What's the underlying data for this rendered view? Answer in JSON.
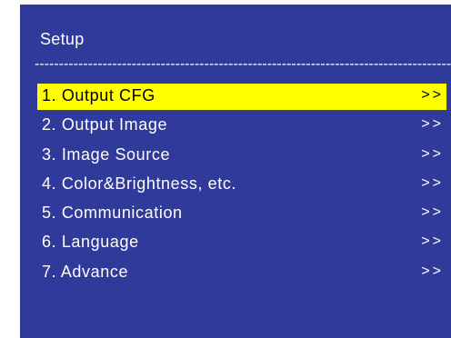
{
  "screen": {
    "title": "Setup",
    "divider": "----------------------------------------------------------------------------------------------------------------"
  },
  "menu": {
    "items": [
      {
        "label": "1. Output CFG",
        "arrow": ">>",
        "selected": true
      },
      {
        "label": "2. Output Image",
        "arrow": ">>",
        "selected": false
      },
      {
        "label": "3. Image Source",
        "arrow": ">>",
        "selected": false
      },
      {
        "label": "4. Color&Brightness, etc.",
        "arrow": ">>",
        "selected": false
      },
      {
        "label": "5. Communication",
        "arrow": ">>",
        "selected": false
      },
      {
        "label": "6. Language",
        "arrow": ">>",
        "selected": false
      },
      {
        "label": "7. Advance",
        "arrow": ">>",
        "selected": false
      }
    ]
  },
  "colors": {
    "background": "#2f3a9a",
    "highlight": "#ffff00",
    "text": "#ffffff",
    "highlight_text": "#000000"
  }
}
